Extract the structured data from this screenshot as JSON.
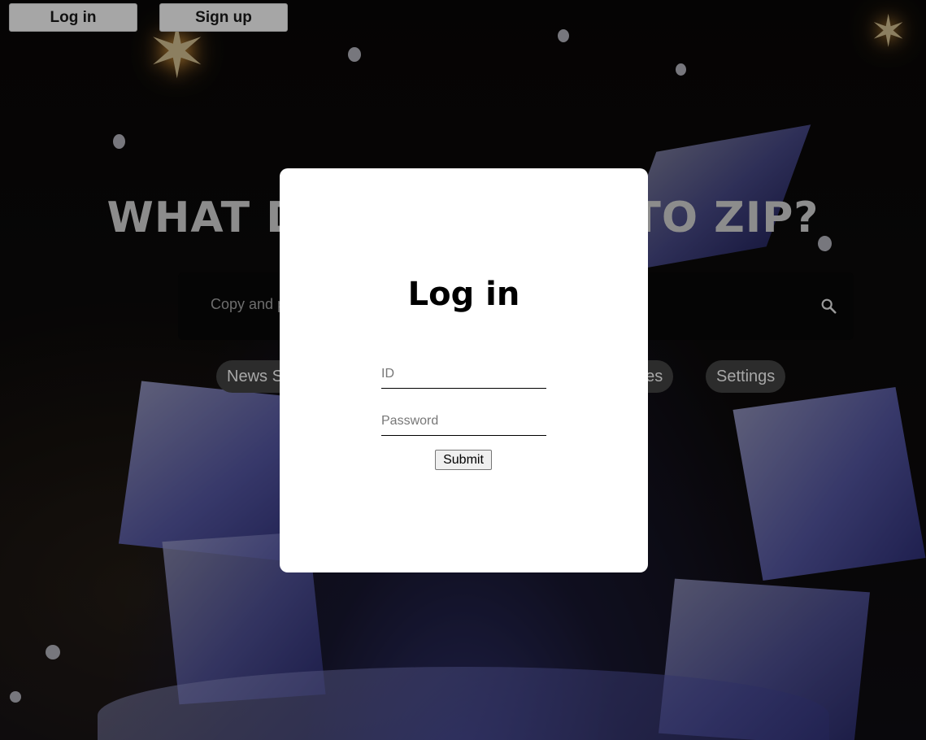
{
  "header": {
    "login_label": "Log in",
    "signup_label": "Sign up"
  },
  "hero": {
    "title": "WHAT DO YOU WANT TO ZIP?",
    "search_placeholder": "Copy and paste the link here"
  },
  "chips": [
    {
      "label": "News Summary"
    },
    {
      "label": "Favorites"
    },
    {
      "label": "Settings"
    }
  ],
  "login_modal": {
    "title": "Log in",
    "id_placeholder": "ID",
    "password_placeholder": "Password",
    "submit_label": "Submit"
  },
  "icons": {
    "search": "search-icon"
  }
}
